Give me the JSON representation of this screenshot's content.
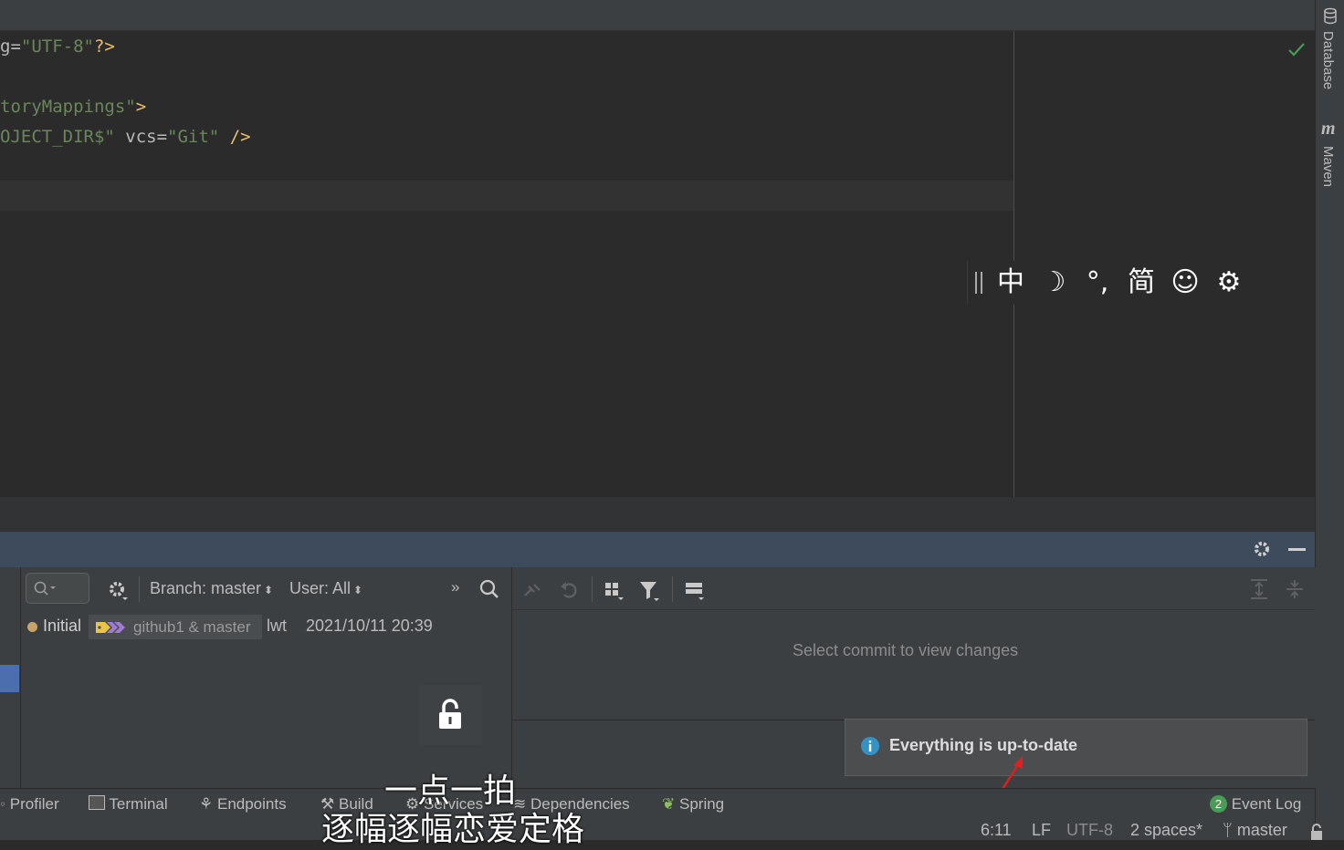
{
  "editor": {
    "lines": [
      {
        "parts": [
          {
            "t": "attr",
            "v": "g="
          },
          {
            "t": "str",
            "v": "\"UTF-8\""
          },
          {
            "t": "tag",
            "v": "?>"
          }
        ]
      },
      {
        "parts": [
          {
            "t": "str",
            "v": "toryMappings\""
          },
          {
            "t": "tag",
            "v": ">"
          }
        ]
      },
      {
        "parts": [
          {
            "t": "str",
            "v": "OJECT_DIR$\""
          },
          {
            "t": "attr",
            "v": " vcs="
          },
          {
            "t": "str",
            "v": "\"Git\""
          },
          {
            "t": "tag",
            "v": " />"
          }
        ]
      }
    ]
  },
  "ime": {
    "items": [
      "中",
      "☽",
      "°,",
      "简",
      "☺",
      "⚙"
    ],
    "icons": [
      "chinese-mode-icon",
      "half-width-icon",
      "punctuation-icon",
      "simplified-icon",
      "emoji-icon",
      "settings-icon"
    ]
  },
  "right_strip": {
    "database": "Database",
    "maven": "Maven"
  },
  "log_toolbar": {
    "branch": "Branch: master",
    "user": "User: All"
  },
  "commit": {
    "message": "Initial",
    "refs": "github1 & master",
    "author": "lwt",
    "date": "2021/10/11 20:39"
  },
  "details": {
    "empty_text": "Select commit to view changes"
  },
  "notification": {
    "text": "Everything is up-to-date"
  },
  "tool_tabs": [
    {
      "label": "Profiler",
      "icon": "profiler-icon"
    },
    {
      "label": "Terminal",
      "icon": "terminal-icon"
    },
    {
      "label": "Endpoints",
      "icon": "endpoints-icon"
    },
    {
      "label": "Build",
      "icon": "build-icon"
    },
    {
      "label": "Services",
      "icon": "services-icon"
    },
    {
      "label": "Dependencies",
      "icon": "dependencies-icon"
    },
    {
      "label": "Spring",
      "icon": "spring-icon"
    }
  ],
  "event_log": {
    "count": "2",
    "label": "Event Log"
  },
  "status_bar": {
    "position": "6:11",
    "line_sep": "LF",
    "encoding": "UTF-8",
    "indent": "2 spaces*",
    "branch": "master"
  },
  "overlay": {
    "line1": "一点一拍",
    "line2": "逐幅逐幅恋爱定格"
  },
  "colors": {
    "accent": "#4b6eaf",
    "panel_header": "#3d4b5c",
    "check": "#499c54"
  }
}
